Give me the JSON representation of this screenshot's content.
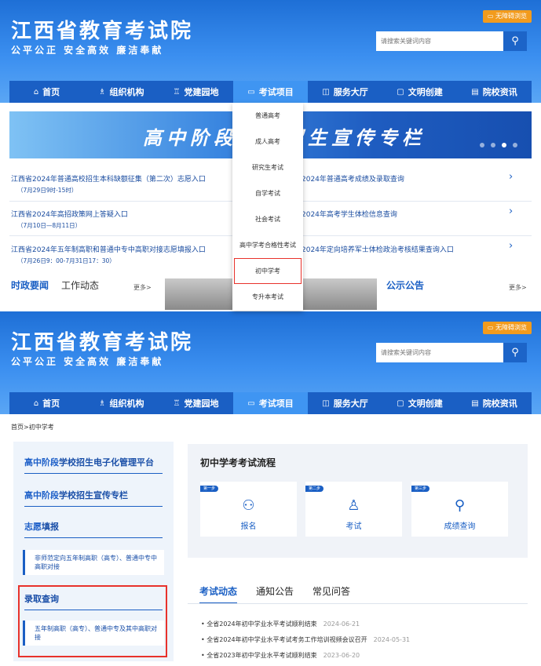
{
  "site": {
    "title": "江西省教育考试院",
    "slogan": "公平公正 安全高效 廉洁奉献",
    "accessibility": "无障碍浏览",
    "search_placeholder": "请搜索关键词内容"
  },
  "nav": [
    {
      "icon": "⌂",
      "label": "首页"
    },
    {
      "icon": "♗",
      "label": "组织机构"
    },
    {
      "icon": "♖",
      "label": "党建园地"
    },
    {
      "icon": "▭",
      "label": "考试项目"
    },
    {
      "icon": "◫",
      "label": "服务大厅"
    },
    {
      "icon": "▢",
      "label": "文明创建"
    },
    {
      "icon": "▤",
      "label": "院校资讯"
    }
  ],
  "banner": {
    "title": "高中阶段学校招生宣传专栏"
  },
  "quick_links": [
    {
      "title": "江西省2024年普通高校招生本科缺额征集（第二次）志愿入口",
      "sub": "（7月29日9时-15时）"
    },
    {
      "title": "2024年普通高考成绩及录取查询",
      "sub": ""
    },
    {
      "title": "江西省2024年高招政策网上答疑入口",
      "sub": "（7月10日—8月11日）"
    },
    {
      "title": "2024年高考学生体检信息查询",
      "sub": ""
    },
    {
      "title": "江西省2024年五年制高职和普通中专中高职对接志愿填报入口",
      "sub": "（7月26日9：00-7月31日17：30）"
    },
    {
      "title": "2024年定向培养军士体检政治考核结果查询入口",
      "sub": ""
    }
  ],
  "news_left": {
    "tab1": "时政要闻",
    "tab2": "工作动态",
    "more": "更多>"
  },
  "news_right": {
    "tab1": "公示公告",
    "more": "更多>"
  },
  "dropdown": [
    "普通高考",
    "成人高考",
    "研究生考试",
    "自学考试",
    "社会考试",
    "高中学考合格性考试",
    "初中学考",
    "专升本考试"
  ],
  "breadcrumb": "首页>初中学考",
  "sidebar": {
    "h1a": "高中阶段",
    "h1b": "学校招生电子化管理平台",
    "h2a": "高中阶段",
    "h2b": "学校招生宣传专栏",
    "h3a": "志愿",
    "h3b": "填报",
    "box1": "非师范定向五年制高职（高专）、普通中专中高职对接",
    "h4": "录取查询",
    "box2": "五年制高职（高专）、普通中专及其中高职对接"
  },
  "process": {
    "title": "初中学考考试流程",
    "steps": [
      {
        "badge": "第一步",
        "label": "报名"
      },
      {
        "badge": "第二步",
        "label": "考试"
      },
      {
        "badge": "第三步",
        "label": "成绩查询"
      }
    ]
  },
  "tabs": [
    "考试动态",
    "通知公告",
    "常见问答"
  ],
  "news_list": [
    {
      "title": "全省2024年初中学业水平考试顺利结束",
      "date": "2024-06-21"
    },
    {
      "title": "全省2024年初中学业水平考试考务工作培训视频会议召开",
      "date": "2024-05-31"
    },
    {
      "title": "全省2023年初中学业水平考试顺利结束",
      "date": "2023-06-20"
    }
  ],
  "colors": {
    "brand": "#1a5fc4",
    "highlight": "#e8322b",
    "accent": "#f29b1d"
  }
}
